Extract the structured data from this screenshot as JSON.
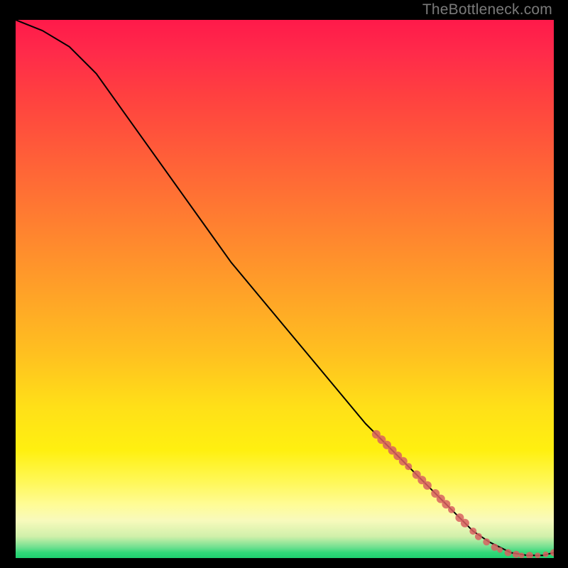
{
  "attribution": "TheBottleneck.com",
  "chart_data": {
    "type": "line",
    "title": "",
    "xlabel": "",
    "ylabel": "",
    "xlim": [
      0,
      100
    ],
    "ylim": [
      0,
      100
    ],
    "grid": false,
    "curve": {
      "x": [
        0,
        5,
        10,
        15,
        20,
        25,
        30,
        35,
        40,
        45,
        50,
        55,
        60,
        65,
        70,
        75,
        80,
        82,
        85,
        88,
        90,
        92,
        95,
        98,
        100
      ],
      "y": [
        100,
        98,
        95,
        90,
        83,
        76,
        69,
        62,
        55,
        49,
        43,
        37,
        31,
        25,
        20,
        15,
        10,
        8,
        5,
        3,
        2,
        1,
        0.5,
        0.5,
        1
      ]
    },
    "scatter_overlay": {
      "color": "#d86060",
      "points": [
        {
          "x": 67,
          "y": 23,
          "size": 6
        },
        {
          "x": 68,
          "y": 22,
          "size": 6
        },
        {
          "x": 69,
          "y": 21,
          "size": 6
        },
        {
          "x": 70,
          "y": 20,
          "size": 6
        },
        {
          "x": 71,
          "y": 19,
          "size": 6
        },
        {
          "x": 72,
          "y": 18,
          "size": 6
        },
        {
          "x": 73,
          "y": 17,
          "size": 5
        },
        {
          "x": 74.5,
          "y": 15.5,
          "size": 6
        },
        {
          "x": 75.5,
          "y": 14.5,
          "size": 6
        },
        {
          "x": 76.5,
          "y": 13.5,
          "size": 6
        },
        {
          "x": 78,
          "y": 12,
          "size": 6
        },
        {
          "x": 79,
          "y": 11,
          "size": 6
        },
        {
          "x": 80,
          "y": 10,
          "size": 6
        },
        {
          "x": 81,
          "y": 9,
          "size": 5
        },
        {
          "x": 82.5,
          "y": 7.5,
          "size": 6
        },
        {
          "x": 83.5,
          "y": 6.5,
          "size": 6
        },
        {
          "x": 85,
          "y": 5,
          "size": 5
        },
        {
          "x": 86,
          "y": 4,
          "size": 5
        },
        {
          "x": 87.5,
          "y": 3,
          "size": 5
        },
        {
          "x": 89,
          "y": 2,
          "size": 5
        },
        {
          "x": 90,
          "y": 1.5,
          "size": 4
        },
        {
          "x": 91.5,
          "y": 1,
          "size": 5
        },
        {
          "x": 93,
          "y": 0.7,
          "size": 5
        },
        {
          "x": 94,
          "y": 0.5,
          "size": 4
        },
        {
          "x": 95.5,
          "y": 0.5,
          "size": 5
        },
        {
          "x": 97,
          "y": 0.5,
          "size": 4
        },
        {
          "x": 98.5,
          "y": 0.7,
          "size": 4
        },
        {
          "x": 100,
          "y": 1,
          "size": 5
        }
      ]
    }
  }
}
